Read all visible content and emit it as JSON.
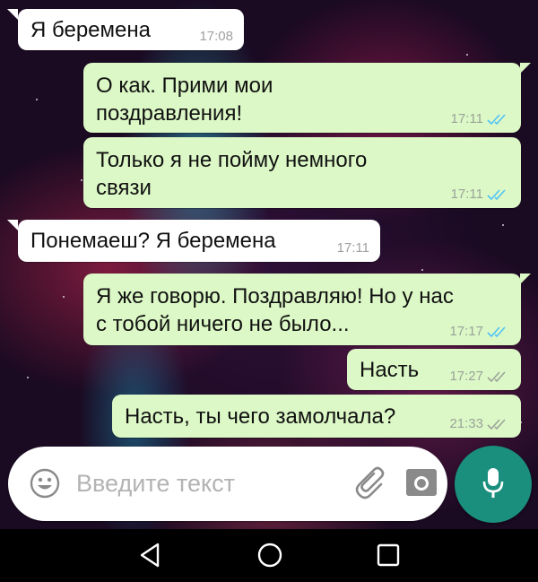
{
  "messages": [
    {
      "text": "Я беремена",
      "time": "17:08",
      "direction": "in"
    },
    {
      "text": "О как. Прими мои\nпоздравления!",
      "time": "17:11",
      "direction": "out",
      "status": "read"
    },
    {
      "text": "Только я не пойму немного\nсвязи",
      "time": "17:11",
      "direction": "out",
      "status": "read"
    },
    {
      "text": "Понемаеш? Я беремена",
      "time": "17:11",
      "direction": "in"
    },
    {
      "text": "Я же говорю. Поздравляю! Но у нас\nс тобой ничего не было...",
      "time": "17:17",
      "direction": "out",
      "status": "read"
    },
    {
      "text": "Насть",
      "time": "17:27",
      "direction": "out",
      "status": "delivered"
    },
    {
      "text": "Насть, ты чего замолчала?",
      "time": "21:33",
      "direction": "out",
      "status": "delivered"
    }
  ],
  "composer": {
    "placeholder": "Введите текст",
    "icons": [
      "emoji-icon",
      "attach-icon",
      "camera-icon",
      "mic-icon"
    ]
  },
  "navbar": {
    "icons": [
      "back-icon",
      "home-icon",
      "recents-icon"
    ]
  },
  "colors": {
    "incoming_bubble": "#ffffff",
    "outgoing_bubble": "#dcf8c6",
    "read_tick": "#4fc3f7",
    "delivered_tick": "#9aa39a",
    "mic_button": "#1b8f7d"
  }
}
